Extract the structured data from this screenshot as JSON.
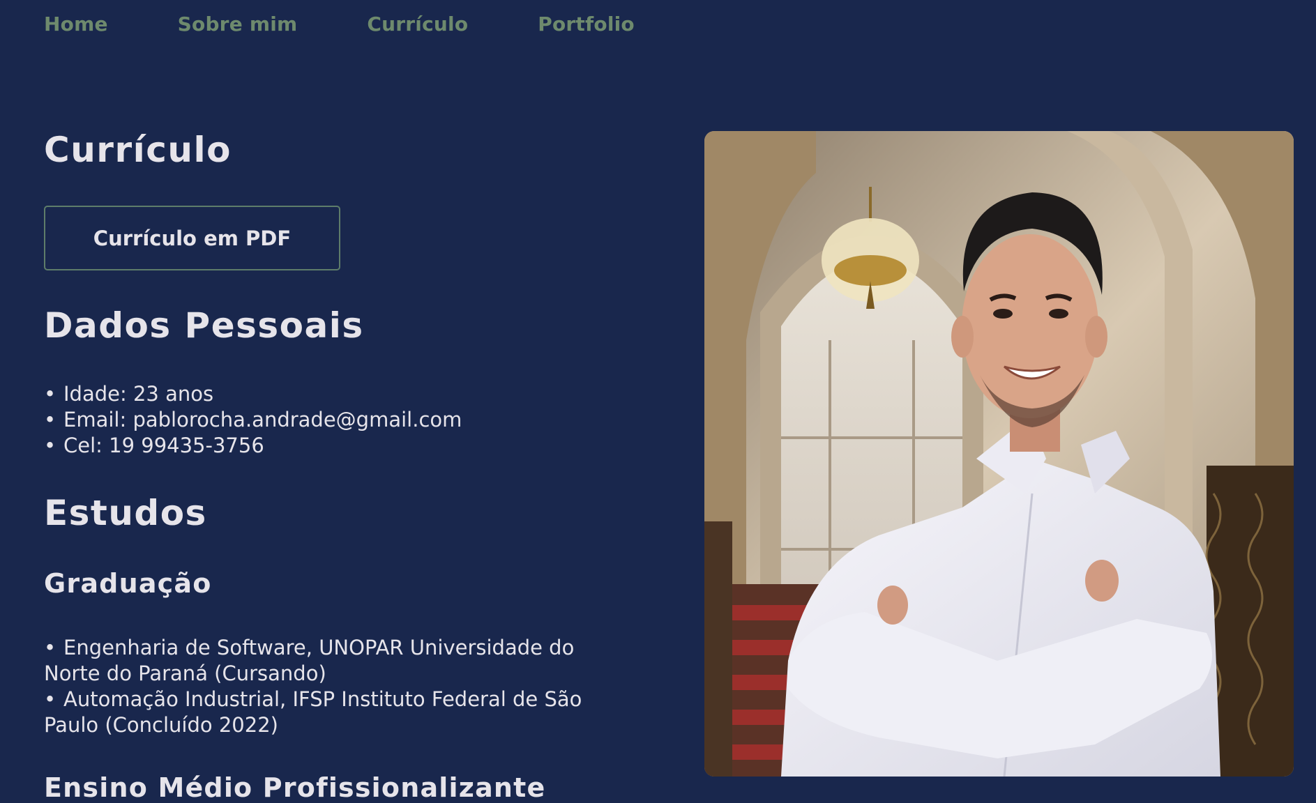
{
  "nav": {
    "items": [
      {
        "label": "Home"
      },
      {
        "label": "Sobre mim"
      },
      {
        "label": "Currículo"
      },
      {
        "label": "Portfolio"
      }
    ]
  },
  "page_title": "Currículo",
  "pdf_button": {
    "label": "Currículo em PDF"
  },
  "personal": {
    "heading": "Dados Pessoais",
    "items": [
      {
        "text": "Idade: 23 anos"
      },
      {
        "text": "Email: pablorocha.andrade@gmail.com"
      },
      {
        "text": "Cel: 19 99435-3756"
      }
    ]
  },
  "studies": {
    "heading": "Estudos",
    "graduation": {
      "heading": "Graduação",
      "items": [
        {
          "line1": "Engenharia de Software, UNOPAR Universidade do",
          "line2": "Norte do Paraná (Cursando)"
        },
        {
          "line1": "Automação Industrial, IFSP Instituto Federal de São",
          "line2": "Paulo (Concluído 2022)"
        }
      ]
    },
    "highschool": {
      "heading": "Ensino Médio Profissionalizante"
    }
  },
  "colors": {
    "background": "#19274d",
    "nav_text": "#6e8a6d",
    "text": "#e6e4ea",
    "button_border": "#5e7d6a"
  }
}
